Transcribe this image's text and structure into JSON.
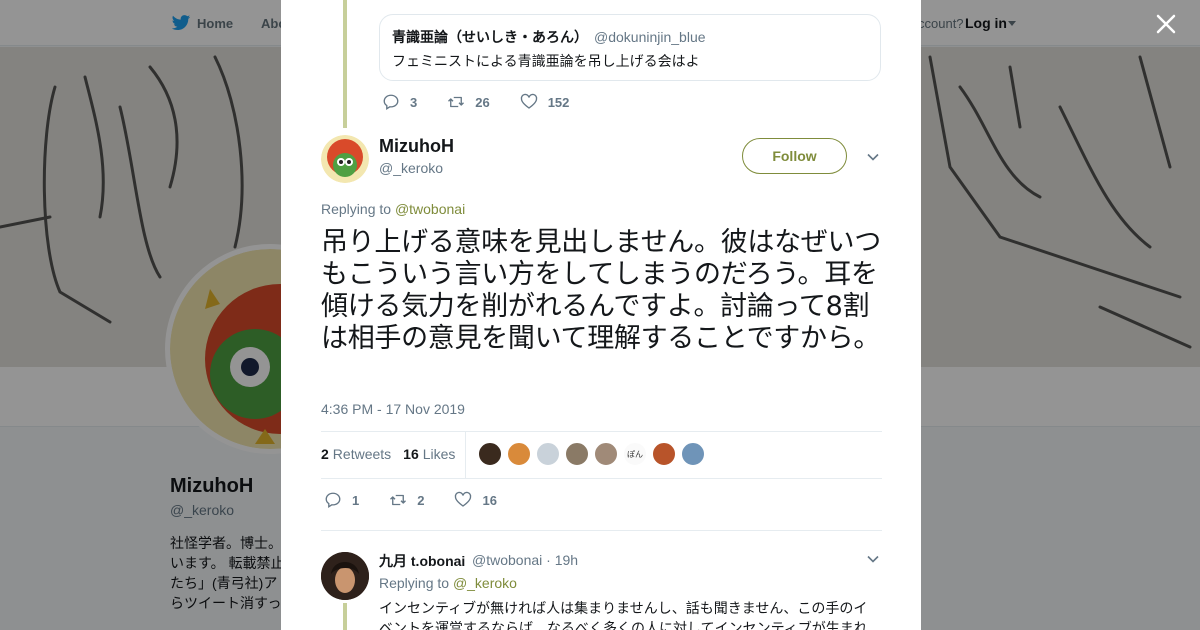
{
  "nav": {
    "home": "Home",
    "about": "Abo",
    "account_prompt": "ccount?",
    "login": "Log in"
  },
  "background_profile": {
    "name": "MizuhoH",
    "handle": "@_keroko",
    "bio_lines": [
      "社怪学者。博士。",
      "います。 転載禁止",
      "たち」(青弓社)ア",
      "らツイート消すっ"
    ]
  },
  "quoted_tweet": {
    "name": "青識亜論（せいしき・あろん）",
    "handle": "@dokuninjin_blue",
    "text": "フェミニストによる青識亜論を吊し上げる会はよ"
  },
  "parent_actions": {
    "replies": "3",
    "retweets": "26",
    "likes": "152"
  },
  "main_tweet": {
    "name": "MizuhoH",
    "handle": "@_keroko",
    "follow_label": "Follow",
    "replying_prefix": "Replying to",
    "replying_to": "@twobonai",
    "text": "吊り上げる意味を見出しません。彼はなぜいつもこういう言い方をしてしまうのだろう。耳を傾ける気力を削がれるんですよ。討論って8割は相手の意見を聞いて理解することですから。",
    "timestamp": "4:36 PM - 17 Nov 2019",
    "retweets_count": "2",
    "retweets_label": "Retweets",
    "likes_count": "16",
    "likes_label": "Likes",
    "liker_badge_text": "ぽん",
    "actions": {
      "replies": "1",
      "retweets": "2",
      "likes": "16"
    }
  },
  "reply_tweet": {
    "name": "九月 t.obonai",
    "handle": "@twobonai",
    "time": "· 19h",
    "replying_prefix": "Replying to",
    "replying_to": "@_keroko",
    "text": "インセンティブが無ければ人は集まりませんし、話も聞きません、この手のイベントを運営するならば、なるべく多くの人に対してインセンティブが生まれ"
  },
  "colors": {
    "accent": "#7f8c3b",
    "thread_line": "#c7cf9a",
    "text_primary": "#14171a",
    "text_secondary": "#657786",
    "twitter_blue": "#1da1f2"
  },
  "icons": [
    "twitter-bird-icon",
    "close-icon",
    "reply-icon",
    "retweet-icon",
    "like-icon",
    "chevron-down-icon"
  ]
}
